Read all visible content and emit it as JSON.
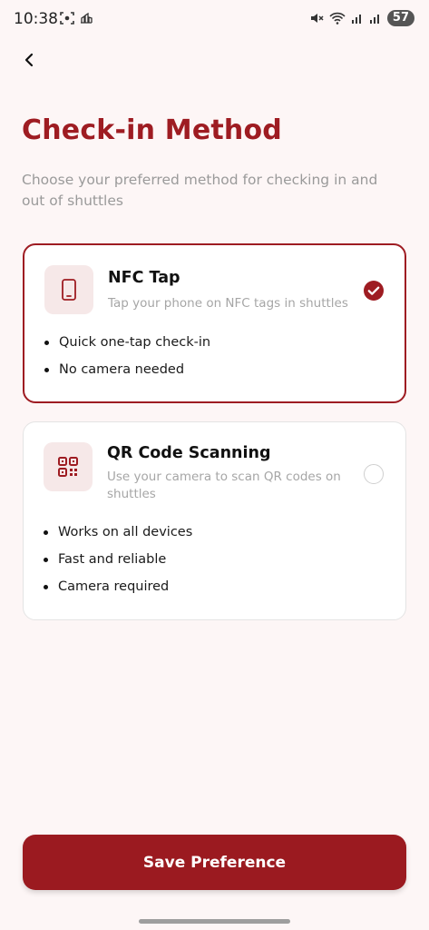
{
  "status_bar": {
    "time": "10:38",
    "battery": "57"
  },
  "header": {
    "title": "Check-in Method",
    "subtitle": "Choose your preferred method for checking in and out of shuttles"
  },
  "options": [
    {
      "id": "nfc",
      "title": "NFC Tap",
      "description": "Tap your phone on NFC tags in shuttles",
      "selected": true,
      "features": [
        "Quick one-tap check-in",
        "No camera needed"
      ]
    },
    {
      "id": "qr",
      "title": "QR Code Scanning",
      "description": "Use your camera to scan QR codes on shuttles",
      "selected": false,
      "features": [
        "Works on all devices",
        "Fast and reliable",
        "Camera required"
      ]
    }
  ],
  "footer": {
    "save_label": "Save Preference"
  },
  "colors": {
    "accent": "#9e1c22",
    "icon_bg": "#f6e8e8",
    "background": "#fdf6f6"
  }
}
